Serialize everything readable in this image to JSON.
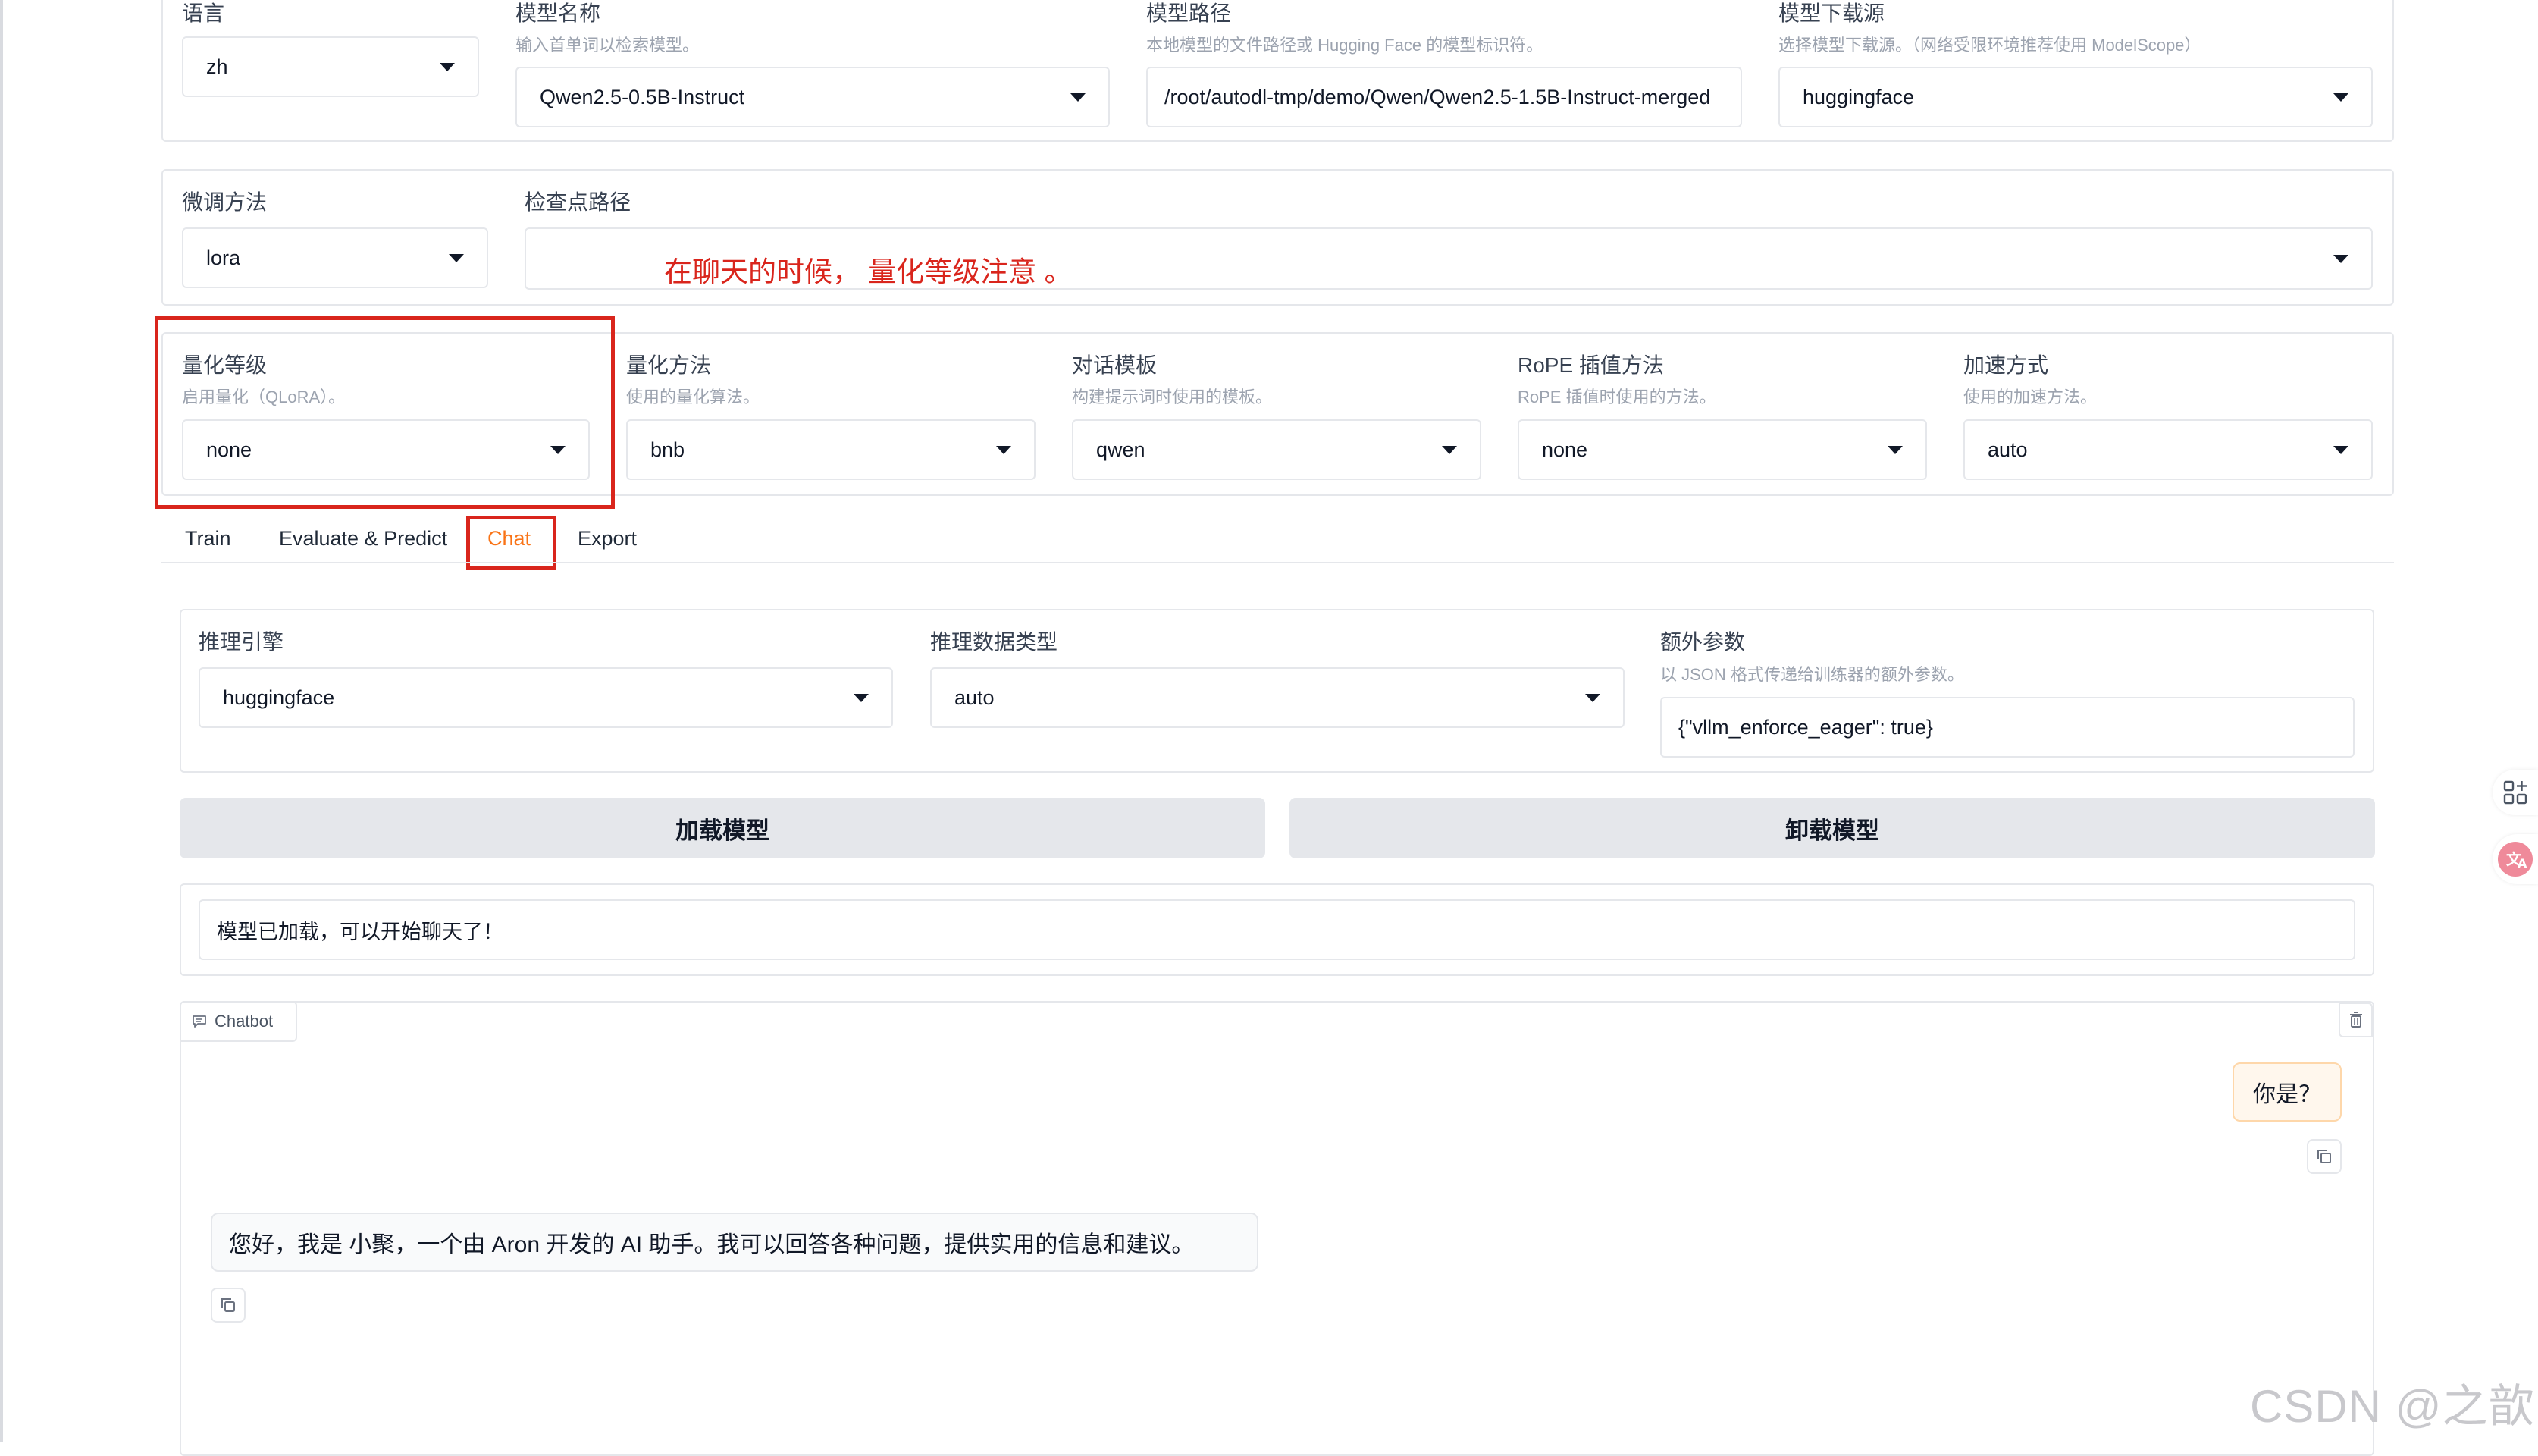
{
  "top_row": {
    "language": {
      "label": "语言",
      "value": "zh"
    },
    "model_name": {
      "label": "模型名称",
      "info": "输入首单词以检索模型。",
      "value": "Qwen2.5-0.5B-Instruct"
    },
    "model_path": {
      "label": "模型路径",
      "info": "本地模型的文件路径或 Hugging Face 的模型标识符。",
      "value": "/root/autodl-tmp/demo/Qwen/Qwen2.5-1.5B-Instruct-merged"
    },
    "model_source": {
      "label": "模型下载源",
      "info": "选择模型下载源。（网络受限环境推荐使用 ModelScope）",
      "value": "huggingface"
    }
  },
  "finetune_row": {
    "method": {
      "label": "微调方法",
      "value": "lora"
    },
    "checkpoint": {
      "label": "检查点路径",
      "value": ""
    }
  },
  "annotation": {
    "text": "在聊天的时候， 量化等级注意 。",
    "color": "#d9251c"
  },
  "advanced_row": {
    "quant_bit": {
      "label": "量化等级",
      "info": "启用量化（QLoRA）。",
      "value": "none"
    },
    "quant_method": {
      "label": "量化方法",
      "info": "使用的量化算法。",
      "value": "bnb"
    },
    "template": {
      "label": "对话模板",
      "info": "构建提示词时使用的模板。",
      "value": "qwen"
    },
    "rope": {
      "label": "RoPE 插值方法",
      "info": "RoPE 插值时使用的方法。",
      "value": "none"
    },
    "booster": {
      "label": "加速方式",
      "info": "使用的加速方法。",
      "value": "auto"
    }
  },
  "tabs": [
    {
      "label": "Train",
      "active": false
    },
    {
      "label": "Evaluate & Predict",
      "active": false
    },
    {
      "label": "Chat",
      "active": true
    },
    {
      "label": "Export",
      "active": false
    }
  ],
  "chat": {
    "infer_backend": {
      "label": "推理引擎",
      "value": "huggingface"
    },
    "infer_dtype": {
      "label": "推理数据类型",
      "value": "auto"
    },
    "extra_args": {
      "label": "额外参数",
      "info": "以 JSON 格式传递给训练器的额外参数。",
      "value": "{\"vllm_enforce_eager\": true}"
    },
    "load_button": "加载模型",
    "unload_button": "卸载模型",
    "status": "模型已加载，可以开始聊天了！",
    "chatbot_label": "Chatbot",
    "messages": [
      {
        "role": "user",
        "text": "你是？"
      },
      {
        "role": "assistant",
        "text": "您好，我是 小聚，一个由 Aron 开发的 AI 助手。我可以回答各种问题，提供实用的信息和建议。"
      }
    ]
  },
  "watermark": "CSDN @之歆",
  "colors": {
    "accent": "#f97316",
    "annotation": "#d9251c",
    "border": "#e5e7eb",
    "button": "#e5e7eb"
  },
  "icons": [
    "dropdown-caret-icon",
    "chat-bubble-icon",
    "trash-icon",
    "copy-icon",
    "grid-plus-icon",
    "translate-icon"
  ]
}
